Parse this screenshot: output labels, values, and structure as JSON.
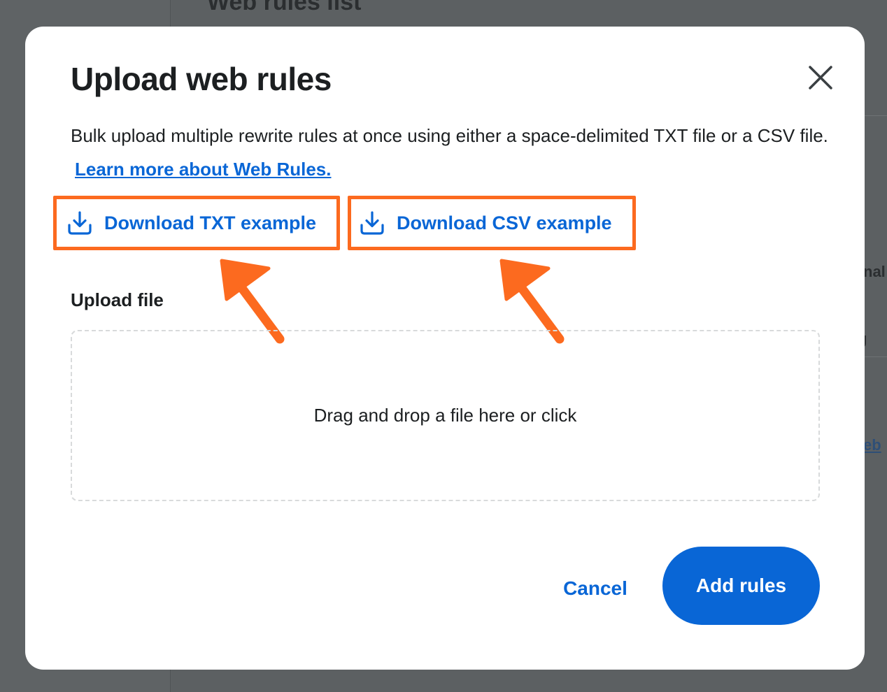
{
  "background": {
    "title": "Web rules list",
    "fragment_1": "nal",
    "fragment_2": "/",
    "fragment_3": "g",
    "fragment_4": ".",
    "fragment_link": "eb "
  },
  "modal": {
    "title": "Upload web rules",
    "close_icon": "close-x-icon",
    "description": "Bulk upload multiple rewrite rules at once using either a space-delimited TXT file or a CSV file.",
    "learn_more_link": "Learn more about Web Rules.",
    "download_txt_label": "Download TXT example",
    "download_csv_label": "Download CSV example",
    "download_icon": "download-icon",
    "upload_label": "Upload file",
    "dropzone_text": "Drag and drop a file here or click",
    "cancel_label": "Cancel",
    "add_rules_label": "Add rules"
  },
  "colors": {
    "accent": "#0966d6",
    "annotation": "#fc6a1f",
    "text": "#1c1f21",
    "overlay": "#5f6365"
  }
}
